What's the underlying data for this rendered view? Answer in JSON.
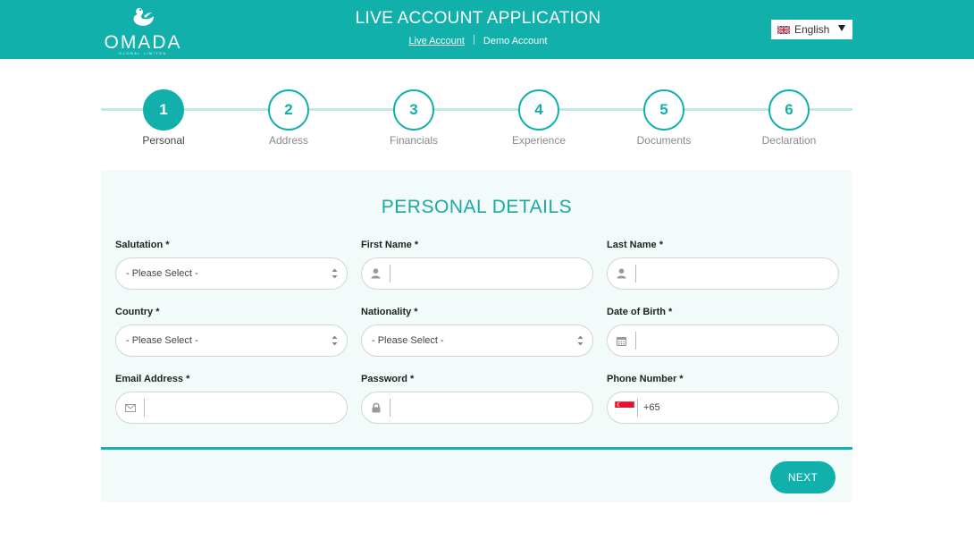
{
  "brand": {
    "name": "OMADA",
    "tagline": "GLOBAL LIMITED"
  },
  "header": {
    "title": "LIVE ACCOUNT APPLICATION",
    "links": [
      "Live Account",
      "Demo Account"
    ],
    "language": {
      "selected": "English",
      "flag_icon": "uk-flag-icon"
    }
  },
  "steps": [
    {
      "number": "1",
      "label": "Personal",
      "active": true
    },
    {
      "number": "2",
      "label": "Address",
      "active": false
    },
    {
      "number": "3",
      "label": "Financials",
      "active": false
    },
    {
      "number": "4",
      "label": "Experience",
      "active": false
    },
    {
      "number": "5",
      "label": "Documents",
      "active": false
    },
    {
      "number": "6",
      "label": "Declaration",
      "active": false
    }
  ],
  "form": {
    "title": "PERSONAL DETAILS",
    "salutation": {
      "label": "Salutation *",
      "value": "- Please Select -"
    },
    "first_name": {
      "label": "First Name *",
      "value": "",
      "icon": "user-icon"
    },
    "last_name": {
      "label": "Last Name *",
      "value": "",
      "icon": "user-icon"
    },
    "country": {
      "label": "Country *",
      "value": "- Please Select -"
    },
    "nationality": {
      "label": "Nationality *",
      "value": "- Please Select -"
    },
    "dob": {
      "label": "Date of Birth *",
      "value": "",
      "icon": "calendar-icon"
    },
    "email": {
      "label": "Email Address *",
      "value": "",
      "icon": "envelope-icon"
    },
    "password": {
      "label": "Password *",
      "value": "",
      "icon": "lock-icon"
    },
    "phone": {
      "label": "Phone Number *",
      "value": "+65",
      "flag_icon": "singapore-flag-icon"
    },
    "next_label": "NEXT"
  },
  "colors": {
    "brand_teal": "#12b0aa",
    "panel_bg": "#f2fbfa",
    "step_line": "#bfe8e6"
  }
}
